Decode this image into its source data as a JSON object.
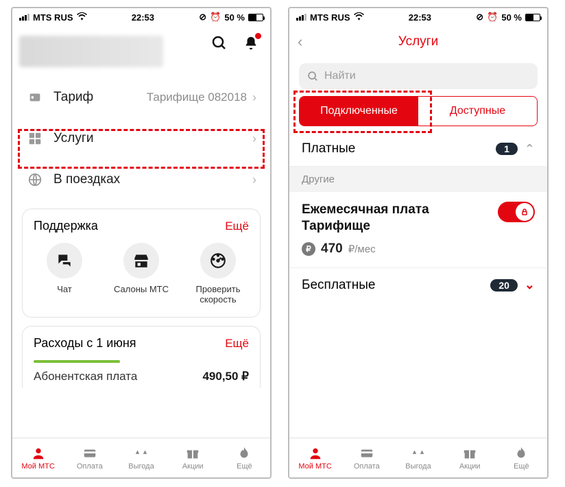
{
  "status": {
    "carrier": "MTS RUS",
    "time": "22:53",
    "battery_pct": "50 %"
  },
  "phone1": {
    "rows": {
      "tariff": {
        "icon": "sim-icon",
        "label": "Тариф",
        "value": "Тарифище 082018"
      },
      "services": {
        "icon": "services-icon",
        "label": "Услуги"
      },
      "roaming": {
        "icon": "globe-icon",
        "label": "В поездках"
      }
    },
    "support": {
      "title": "Поддержка",
      "more": "Ещё",
      "items": [
        {
          "label": "Чат"
        },
        {
          "label": "Салоны МТС"
        },
        {
          "label": "Проверить скорость"
        }
      ]
    },
    "expenses": {
      "title": "Расходы с 1 июня",
      "more": "Ещё",
      "line_label": "Абонентская плата",
      "line_value": "490,50 ₽"
    }
  },
  "phone2": {
    "title": "Услуги",
    "search_placeholder": "Найти",
    "segments": {
      "connected": "Подключенные",
      "available": "Доступные"
    },
    "paid": {
      "label": "Платные",
      "count": "1"
    },
    "group_other": "Другие",
    "service": {
      "name": "Ежемесячная плата Тарифище",
      "price": "470",
      "unit": "₽/мес"
    },
    "free": {
      "label": "Бесплатные",
      "count": "20"
    }
  },
  "nav": {
    "my": "Мой МТС",
    "pay": "Оплата",
    "benefit": "Выгода",
    "promo": "Акции",
    "more": "Ещё"
  }
}
